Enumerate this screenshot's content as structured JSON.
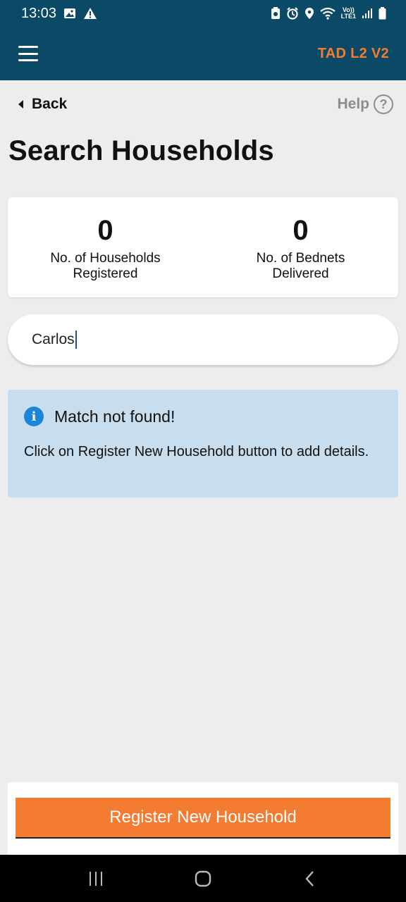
{
  "status_bar": {
    "time": "13:03",
    "lte_top": "Vo))",
    "lte_bottom": "LTE1"
  },
  "app_bar": {
    "title": "TAD L2 V2",
    "accent_color": "#f47b32",
    "background_color": "#0b4a66"
  },
  "nav": {
    "back_label": "Back",
    "help_label": "Help",
    "help_symbol": "?"
  },
  "page": {
    "title": "Search Households"
  },
  "stats": [
    {
      "value": "0",
      "label": "No. of Households Registered"
    },
    {
      "value": "0",
      "label": "No. of Bednets Delivered"
    }
  ],
  "search": {
    "value": "Carlos"
  },
  "info": {
    "icon": "i",
    "title": "Match not found!",
    "message": "Click on Register New Household button to add details."
  },
  "actions": {
    "register_label": "Register New Household"
  }
}
